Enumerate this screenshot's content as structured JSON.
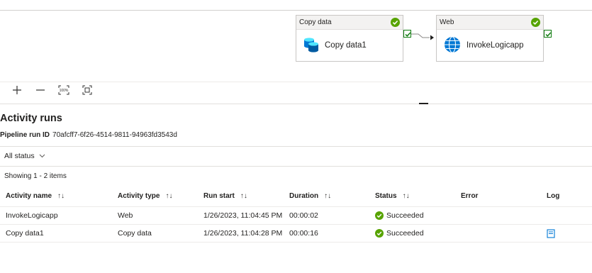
{
  "pipeline": {
    "nodes": [
      {
        "type": "Copy data",
        "name": "Copy data1",
        "icon": "database-icon"
      },
      {
        "type": "Web",
        "name": "InvokeLogicapp",
        "icon": "globe-icon"
      }
    ],
    "zoom_tools": {
      "zoom_in": "+",
      "zoom_out": "—",
      "reset_label": "100%"
    }
  },
  "activity_runs": {
    "title": "Activity runs",
    "pipeline_run_id_label": "Pipeline run ID",
    "pipeline_run_id": "70afcff7-6f26-4514-9811-94963fd3543d",
    "filter_label": "All status",
    "showing_text": "Showing 1 - 2 items",
    "columns": [
      "Activity name",
      "Activity type",
      "Run start",
      "Duration",
      "Status",
      "Error",
      "Log"
    ],
    "rows": [
      {
        "name": "InvokeLogicapp",
        "type": "Web",
        "run_start": "1/26/2023, 11:04:45 PM",
        "duration": "00:00:02",
        "status": "Succeeded",
        "error": "",
        "has_log": false
      },
      {
        "name": "Copy data1",
        "type": "Copy data",
        "run_start": "1/26/2023, 11:04:28 PM",
        "duration": "00:00:16",
        "status": "Succeeded",
        "error": "",
        "has_log": true
      }
    ]
  },
  "colors": {
    "success": "#57a300",
    "accent": "#0078d4"
  }
}
